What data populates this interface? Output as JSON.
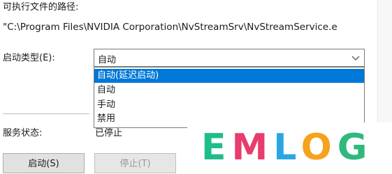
{
  "exe_path_label": "可执行文件的路径:",
  "exe_path_value": "\"C:\\Program Files\\NVIDIA Corporation\\NvStreamSrv\\NvStreamService.e",
  "startup_type": {
    "label": "启动类型(E):",
    "selected_value": "自动",
    "options": [
      "自动(延迟启动)",
      "自动",
      "手动",
      "禁用"
    ],
    "highlighted_option": "自动(延迟启动)"
  },
  "service_status": {
    "label": "服务状态:",
    "value": "已停止"
  },
  "buttons": {
    "start": "启动(S)",
    "stop": "停止(T)"
  },
  "watermark": {
    "text": "EMLOG",
    "letter_colors": [
      "#1fbd8a",
      "#e93c6c",
      "#2aa7e2",
      "#f6a21d",
      "#2fb97f"
    ]
  },
  "colors": {
    "selection": "#0078d7"
  }
}
